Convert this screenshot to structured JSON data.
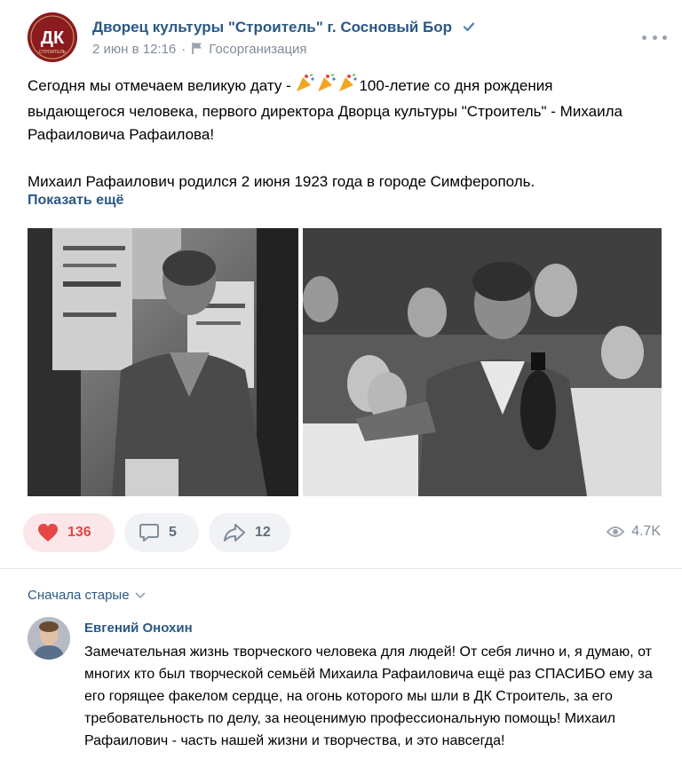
{
  "post": {
    "group_name": "Дворец культуры \"Строитель\" г. Сосновый Бор",
    "date": "2 июн в 12:16",
    "separator": "·",
    "org_type": "Госорганизация",
    "avatar_text": "ДК",
    "avatar_subtext": "СТРОИТЕЛЬ",
    "text_line1_before": "Сегодня мы отмечаем великую дату - ",
    "text_line1_after": "100-летие со дня рождения выдающегося человека, первого директора Дворца культуры \"Строитель\" - Михаила Рафаиловича Рафаилова!",
    "text_paragraph2": "Михаил Рафаилович родился 2 июня 1923 года в городе Симферополь.",
    "show_more": "Показать ещё",
    "icons": {
      "verified": "verified-check-icon",
      "flag": "flag-icon",
      "more": "more-dots-icon",
      "emoji": "party-popper-icon"
    }
  },
  "actions": {
    "likes": "136",
    "comments": "5",
    "shares": "12",
    "views": "4.7K"
  },
  "comments_section": {
    "sort_label": "Сначала старые",
    "comment": {
      "author": "Евгений Онохин",
      "text": "Замечательная жизнь творческого человека для людей! От себя лично и, я думаю, от многих кто был творческой семьёй Михаила Рафаиловича ещё раз СПАСИБО ему за его горящее факелом сердце, на огонь которого мы шли в ДК Строитель, за его требовательность по делу, за неоценимую профессиональную помощь! Михаил Рафаилович - часть нашей жизни и творчества, и это навсегда!"
    }
  },
  "colors": {
    "link": "#2a5885",
    "secondary": "#818c99",
    "like_red": "#e64646",
    "like_bg": "#fbe7ea",
    "button_bg": "#f0f2f5"
  }
}
